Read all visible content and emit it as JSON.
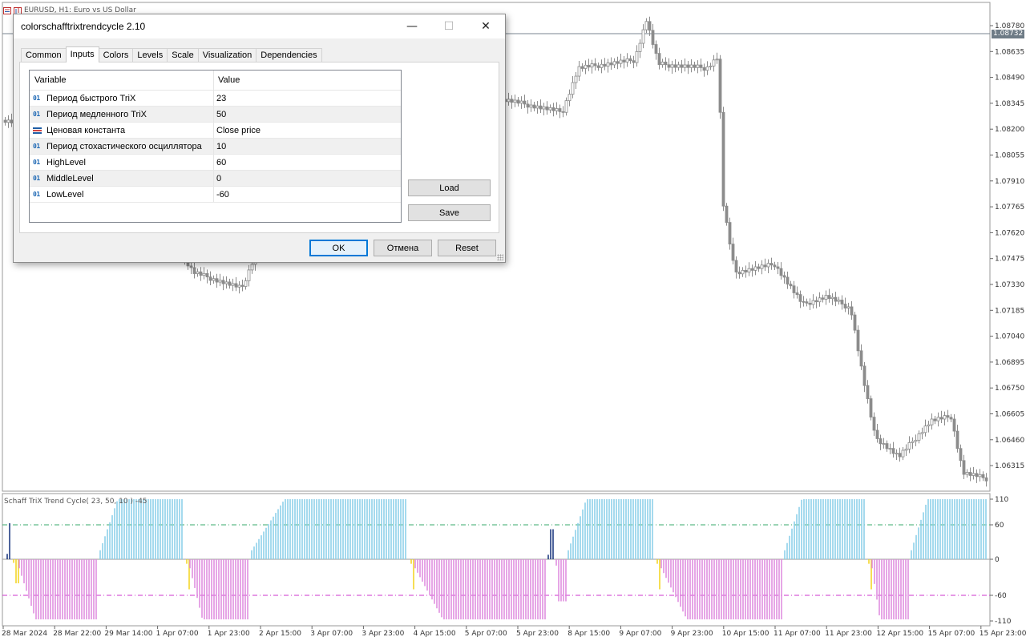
{
  "chart": {
    "symbol_caption": "EURUSD, H1:  Euro vs US Dollar",
    "current_price": "1.08732",
    "price_axis": [
      "1.08780",
      "1.08635",
      "1.08490",
      "1.08345",
      "1.08200",
      "1.08055",
      "1.07910",
      "1.07765",
      "1.07620",
      "1.07475",
      "1.07330",
      "1.07185",
      "1.07040",
      "1.06895",
      "1.06750",
      "1.06605",
      "1.06460",
      "1.06315"
    ],
    "time_axis": [
      "28 Mar 2024",
      "28 Mar 22:00",
      "29 Mar 14:00",
      "1 Apr 07:00",
      "1 Apr 23:00",
      "2 Apr 15:00",
      "3 Apr 07:00",
      "3 Apr 23:00",
      "4 Apr 15:00",
      "5 Apr 07:00",
      "5 Apr 23:00",
      "8 Apr 15:00",
      "9 Apr 07:00",
      "9 Apr 23:00",
      "10 Apr 15:00",
      "11 Apr 07:00",
      "11 Apr 23:00",
      "12 Apr 15:00",
      "15 Apr 07:00",
      "15 Apr 23:00"
    ],
    "indicator_title": "Schaff TriX Trend Cycle( 23, 50, 10 ) -45",
    "indicator_axis": [
      "110",
      "60",
      "0",
      "-60",
      "-110"
    ],
    "colors": {
      "candle": "#8c8c8c",
      "bull_bar": "#87cee8",
      "bear_bar": "#dd88dd",
      "up_level": "#3aa86b",
      "down_level": "#cc33cc",
      "yellow": "#f2d21b",
      "dark_blue": "#13317a"
    }
  },
  "dialog": {
    "title": "colorschafftrixtrendcycle 2.10",
    "minimize_glyph": "—",
    "maximize_glyph": "☐",
    "close_glyph": "✕",
    "tabs": [
      {
        "label": "Common"
      },
      {
        "label": "Inputs",
        "active": true
      },
      {
        "label": "Colors"
      },
      {
        "label": "Levels"
      },
      {
        "label": "Scale"
      },
      {
        "label": "Visualization"
      },
      {
        "label": "Dependencies"
      }
    ],
    "grid": {
      "col_variable": "Variable",
      "col_value": "Value",
      "rows": [
        {
          "type": "01",
          "variable": "Период быстрого TriX",
          "value": "23"
        },
        {
          "type": "01",
          "variable": "Период медленного TriX",
          "value": "50"
        },
        {
          "type": "enum",
          "variable": "Ценовая константа",
          "value": "Close price"
        },
        {
          "type": "01",
          "variable": "Период стохастического осциллятора",
          "value": "10"
        },
        {
          "type": "01",
          "variable": "HighLevel",
          "value": "60"
        },
        {
          "type": "01",
          "variable": "MiddleLevel",
          "value": "0"
        },
        {
          "type": "01",
          "variable": "LowLevel",
          "value": "-60"
        }
      ]
    },
    "load_label": "Load",
    "save_label": "Save",
    "ok_label": "OK",
    "cancel_label": "Отмена",
    "reset_label": "Reset"
  }
}
